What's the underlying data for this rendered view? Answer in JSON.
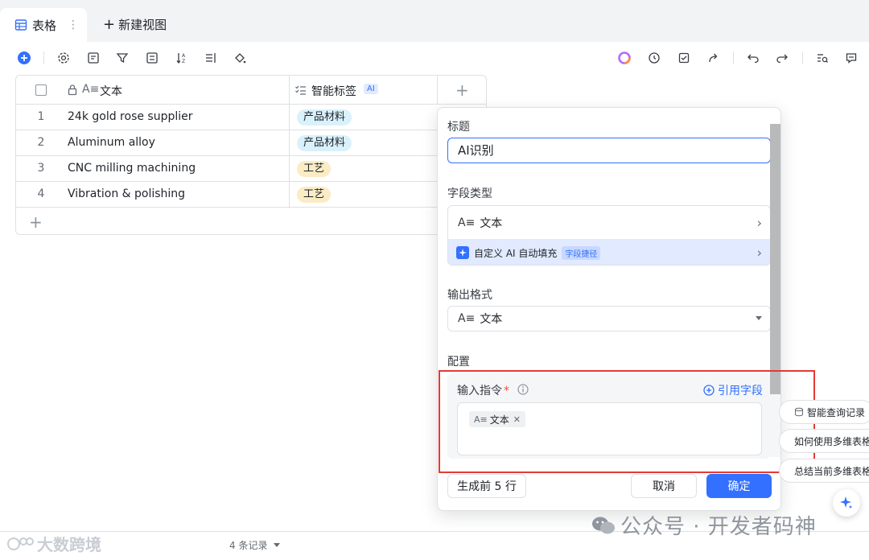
{
  "tabs": {
    "active_label": "表格",
    "more_label": "⋮",
    "new_view_label": "新建视图"
  },
  "table": {
    "columns": [
      {
        "label": "文本"
      },
      {
        "label": "智能标签",
        "badge": "AI"
      }
    ],
    "add_column": "+",
    "rows": [
      {
        "num": "1",
        "text": "24k gold rose supplier",
        "tag": "产品材料",
        "tag_color": "#d9f1fb"
      },
      {
        "num": "2",
        "text": "Aluminum alloy",
        "tag": "产品材料",
        "tag_color": "#d9f1fb"
      },
      {
        "num": "3",
        "text": "CNC milling machining",
        "tag": "工艺",
        "tag_color": "#fbecc5"
      },
      {
        "num": "4",
        "text": "Vibration & polishing",
        "tag": "工艺",
        "tag_color": "#fbecc5"
      }
    ],
    "add_row": "+"
  },
  "panel": {
    "title_label": "标题",
    "title_value": "AI识别",
    "field_type_label": "字段类型",
    "field_type_value": "文本",
    "ai_fill_label": "自定义 AI 自动填充",
    "ai_fill_badge": "字段捷径",
    "output_format_label": "输出格式",
    "output_format_value": "文本",
    "config_label": "配置",
    "instruction_label": "输入指令",
    "required_mark": "*",
    "ref_field_label": "引用字段",
    "chip_label": "文本",
    "generate_label": "生成前 5 行",
    "cancel_label": "取消",
    "ok_label": "确定"
  },
  "help": {
    "items": [
      "智能查询记录",
      "如何使用多维表格",
      "总结当前多维表格"
    ]
  },
  "footer": {
    "record_count": "4 条记录"
  },
  "watermarks": {
    "left": "大数跨境",
    "right": "公众号 · 开发者码神"
  },
  "colors": {
    "accent": "#3370ff",
    "annotation": "#e53935",
    "tag_blue": "#d9f1fb",
    "tag_yellow": "#fbecc5"
  },
  "icons": [
    "table-icon",
    "add-circle-icon",
    "settings-icon",
    "form-icon",
    "filter-icon",
    "group-icon",
    "sort-icon",
    "row-height-icon",
    "paint-bucket-icon",
    "ai-orb-icon",
    "history-icon",
    "task-icon",
    "share-icon",
    "undo-icon",
    "redo-icon",
    "search-list-icon",
    "comment-icon",
    "lock-icon",
    "text-field-icon",
    "multi-select-icon",
    "chevron-right-icon",
    "sparkle-icon",
    "info-icon",
    "plus-circle-icon",
    "close-icon"
  ]
}
